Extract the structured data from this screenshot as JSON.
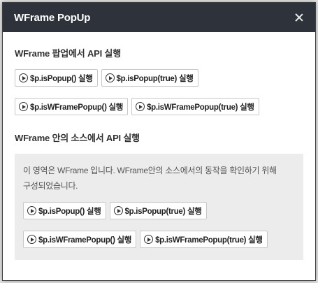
{
  "popup": {
    "title": "WFrame PopUp"
  },
  "section1": {
    "title": "WFrame 팝업에서 API 실행",
    "buttons_row1": [
      "$p.isPopup() 실행",
      "$p.isPopup(true) 실행"
    ],
    "buttons_row2": [
      "$p.isWFramePopup() 실행",
      "$p.isWFramePopup(true) 실행"
    ]
  },
  "section2": {
    "title": "WFrame 안의 소스에서 API 실행",
    "description_line1": "이 영역은 WFrame 입니다. WFrame안의 소스에서의 동작을 확인하기 위해",
    "description_line2": "구성되었습니다.",
    "buttons_row1": [
      "$p.isPopup() 실행",
      "$p.isPopup(true) 실행"
    ],
    "buttons_row2": [
      "$p.isWFramePopup() 실행",
      "$p.isWFramePopup(true) 실행"
    ]
  },
  "icons": {
    "play": "play-circle-icon",
    "close": "close-icon"
  },
  "colors": {
    "header_bg": "#2e333b",
    "source_box_bg": "#ececec"
  }
}
